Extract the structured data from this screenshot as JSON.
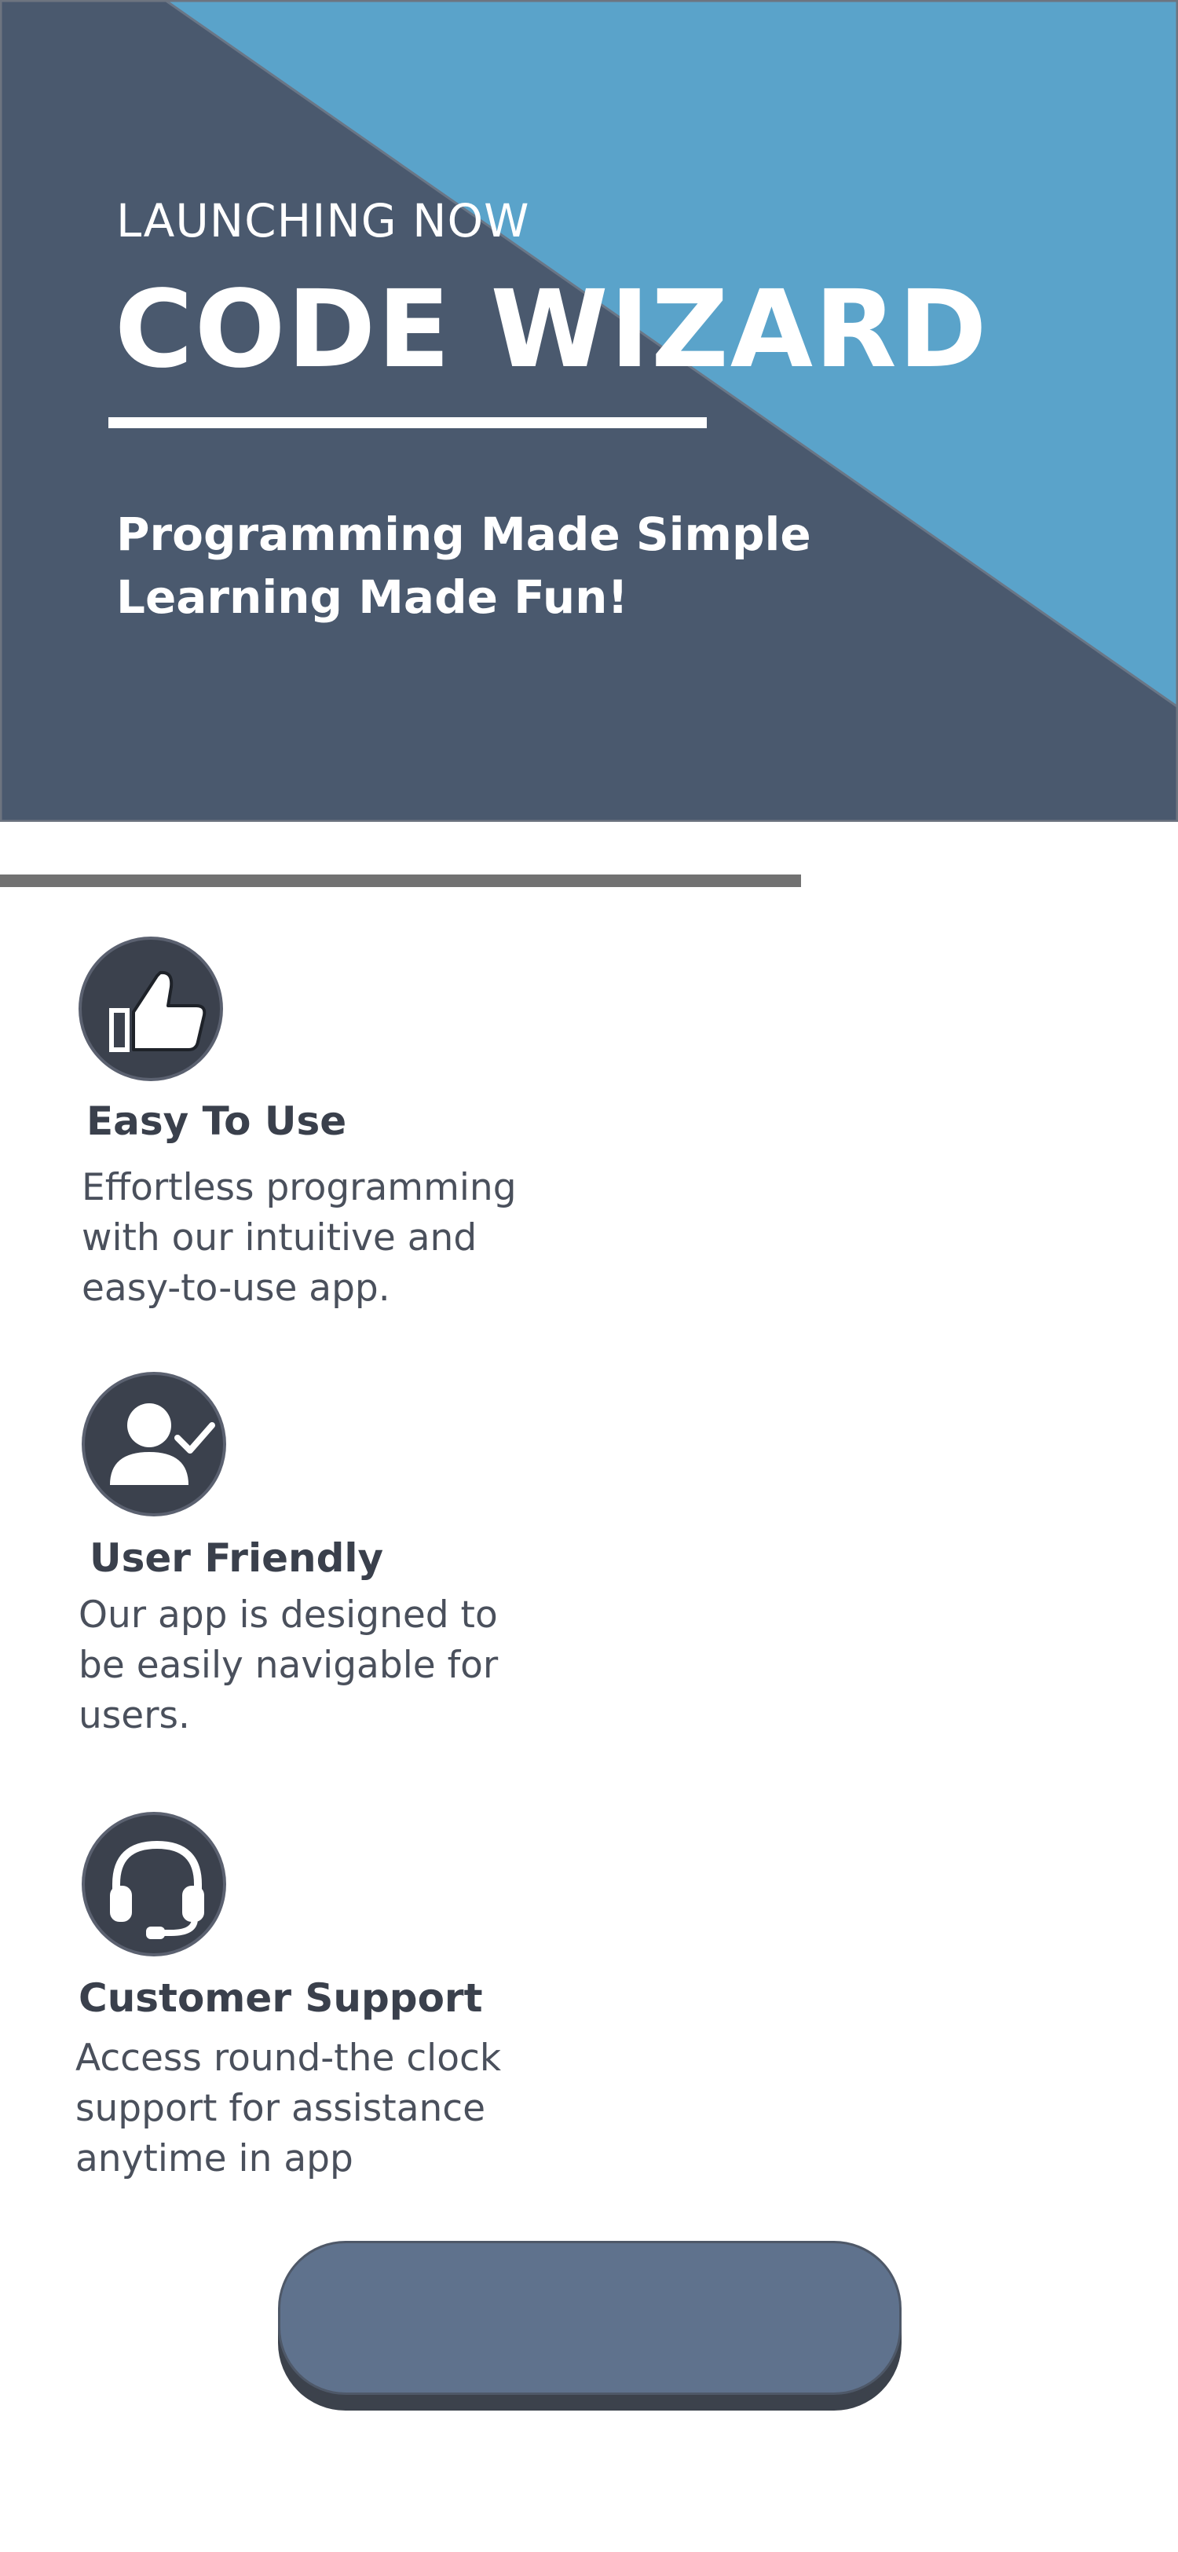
{
  "hero": {
    "kicker": "LAUNCHING NOW",
    "title": "CODE WIZARD",
    "tagline_line1": "Programming Made Simple",
    "tagline_line2": "Learning Made Fun!"
  },
  "colors": {
    "hero_dark": "#4a596e",
    "hero_accent": "#5aa3ca",
    "icon_bg": "#3b414d",
    "text_dark": "#3a404c",
    "divider": "#727272",
    "button": "#5f728d"
  },
  "features": [
    {
      "icon": "thumbs-up-icon",
      "title": "Easy To Use",
      "desc_lines": [
        "Effortless programming",
        "with our intuitive and",
        "easy-to-use app."
      ]
    },
    {
      "icon": "user-check-icon",
      "title": "User Friendly",
      "desc_lines": [
        "Our app is designed to",
        "be easily navigable for",
        "users."
      ]
    },
    {
      "icon": "headset-icon",
      "title": "Customer Support",
      "desc_lines": [
        "Access round-the clock",
        "support for assistance",
        "anytime in app"
      ]
    }
  ],
  "cta": {
    "label": ""
  }
}
